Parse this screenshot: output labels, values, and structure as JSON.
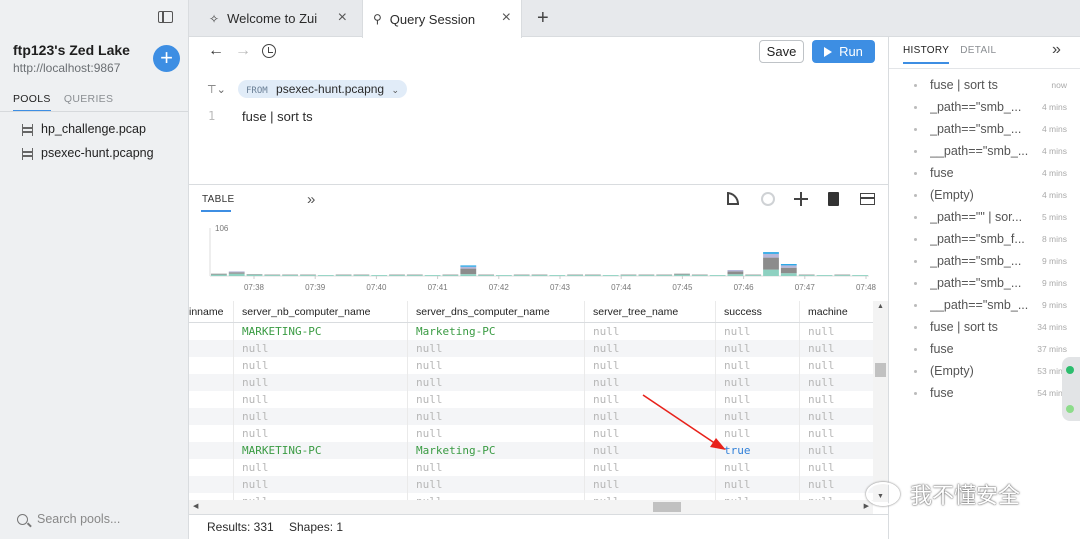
{
  "sidebar": {
    "lake_title": "ftp123's Zed Lake",
    "lake_url": "http://localhost:9867",
    "tabs": [
      "POOLS",
      "QUERIES"
    ],
    "pools": [
      "hp_challenge.pcap",
      "psexec-hunt.pcapng"
    ],
    "search_placeholder": "Search pools..."
  },
  "tabs": [
    {
      "label": "Welcome to Zui",
      "icon": "zui-logo-icon"
    },
    {
      "label": "Query Session",
      "icon": "search-icon"
    }
  ],
  "toolbar": {
    "save_label": "Save",
    "run_label": "Run"
  },
  "editor": {
    "from_keyword": "FROM",
    "from_pool": "psexec-hunt.pcapng",
    "line_number": "1",
    "query": "fuse | sort ts"
  },
  "results": {
    "tab_label": "TABLE",
    "status_results": "Results: 331",
    "status_shapes": "Shapes: 1"
  },
  "histogram": {
    "ymax_label": "106",
    "x_labels": [
      "07:38",
      "07:39",
      "07:40",
      "07:41",
      "07:42",
      "07:43",
      "07:44",
      "07:45",
      "07:46",
      "07:47",
      "07:48"
    ],
    "bars": [
      [
        0.03,
        0.02,
        0,
        0
      ],
      [
        0.05,
        0.03,
        0.02,
        0
      ],
      [
        0.03,
        0.01,
        0,
        0
      ],
      [
        0.02,
        0.01,
        0,
        0
      ],
      [
        0.02,
        0.01,
        0,
        0
      ],
      [
        0.02,
        0.01,
        0,
        0
      ],
      [
        0.02,
        0,
        0,
        0
      ],
      [
        0.02,
        0.01,
        0,
        0
      ],
      [
        0.02,
        0.01,
        0,
        0
      ],
      [
        0.02,
        0,
        0,
        0
      ],
      [
        0.02,
        0.01,
        0,
        0
      ],
      [
        0.02,
        0.01,
        0,
        0
      ],
      [
        0.02,
        0,
        0,
        0
      ],
      [
        0.02,
        0.01,
        0,
        0
      ],
      [
        0.04,
        0.12,
        0.04,
        0.03
      ],
      [
        0.02,
        0.01,
        0,
        0
      ],
      [
        0.02,
        0,
        0,
        0
      ],
      [
        0.02,
        0.01,
        0,
        0
      ],
      [
        0.02,
        0.01,
        0,
        0
      ],
      [
        0.02,
        0,
        0,
        0
      ],
      [
        0.02,
        0.01,
        0,
        0
      ],
      [
        0.02,
        0.01,
        0,
        0
      ],
      [
        0.02,
        0,
        0,
        0
      ],
      [
        0.02,
        0.01,
        0,
        0
      ],
      [
        0.02,
        0.01,
        0,
        0
      ],
      [
        0.02,
        0.01,
        0,
        0
      ],
      [
        0.03,
        0.02,
        0,
        0
      ],
      [
        0.02,
        0.01,
        0,
        0
      ],
      [
        0.02,
        0,
        0,
        0
      ],
      [
        0.04,
        0.06,
        0.03,
        0
      ],
      [
        0.02,
        0.01,
        0,
        0
      ],
      [
        0.14,
        0.26,
        0.08,
        0.04
      ],
      [
        0.06,
        0.12,
        0.05,
        0.03
      ],
      [
        0.02,
        0.01,
        0,
        0
      ],
      [
        0.02,
        0,
        0,
        0
      ],
      [
        0.02,
        0.01,
        0,
        0
      ],
      [
        0.02,
        0,
        0,
        0
      ]
    ],
    "colors": [
      "#8ed1c1",
      "#8c8c8c",
      "#b7b7d9",
      "#2ea8e6"
    ]
  },
  "table": {
    "columns": [
      "inname",
      "server_nb_computer_name",
      "server_dns_computer_name",
      "server_tree_name",
      "success",
      "machine"
    ],
    "rows": [
      [
        "",
        "MARKETING-PC",
        "Marketing-PC",
        "null",
        "null",
        "null"
      ],
      [
        "",
        "null",
        "null",
        "null",
        "null",
        "null"
      ],
      [
        "",
        "null",
        "null",
        "null",
        "null",
        "null"
      ],
      [
        "",
        "null",
        "null",
        "null",
        "null",
        "null"
      ],
      [
        "",
        "null",
        "null",
        "null",
        "null",
        "null"
      ],
      [
        "",
        "null",
        "null",
        "null",
        "null",
        "null"
      ],
      [
        "",
        "null",
        "null",
        "null",
        "null",
        "null"
      ],
      [
        "",
        "MARKETING-PC",
        "Marketing-PC",
        "null",
        "true",
        "null"
      ],
      [
        "",
        "null",
        "null",
        "null",
        "null",
        "null"
      ],
      [
        "",
        "null",
        "null",
        "null",
        "null",
        "null"
      ],
      [
        "",
        "null",
        "null",
        "null",
        "null",
        "null"
      ]
    ]
  },
  "right_panel": {
    "tabs": [
      "HISTORY",
      "DETAIL"
    ],
    "history": [
      {
        "query": "fuse | sort ts",
        "time": "now"
      },
      {
        "query": "_path==\"smb_...",
        "time": "4 mins"
      },
      {
        "query": "_path==\"smb_...",
        "time": "4 mins"
      },
      {
        "query": "__path==\"smb_...",
        "time": "4 mins"
      },
      {
        "query": "fuse",
        "time": "4 mins"
      },
      {
        "query": "(Empty)",
        "time": "4 mins"
      },
      {
        "query": "_path==\"\" | sor...",
        "time": "5 mins"
      },
      {
        "query": "_path==\"smb_f...",
        "time": "8 mins"
      },
      {
        "query": "_path==\"smb_...",
        "time": "9 mins"
      },
      {
        "query": "_path==\"smb_...",
        "time": "9 mins"
      },
      {
        "query": "__path==\"smb_...",
        "time": "9 mins"
      },
      {
        "query": "fuse | sort ts",
        "time": "34 mins"
      },
      {
        "query": "fuse",
        "time": "37 mins"
      },
      {
        "query": "(Empty)",
        "time": "53 mins"
      },
      {
        "query": "fuse",
        "time": "54 mins"
      }
    ]
  },
  "watermark": "我不懂安全"
}
